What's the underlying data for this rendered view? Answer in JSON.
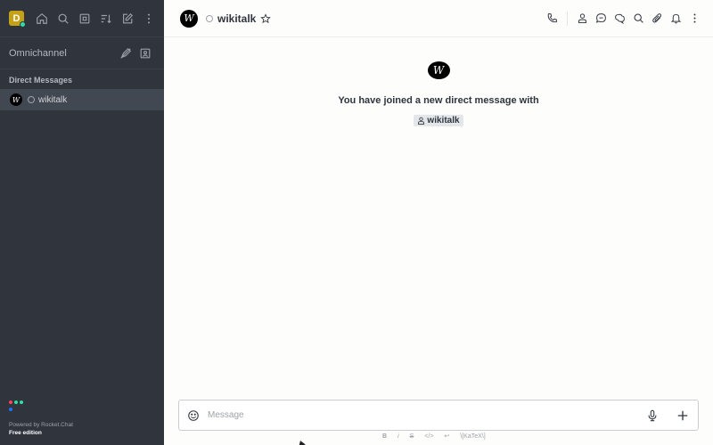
{
  "user": {
    "initial": "D",
    "status_color": "#2de0a5",
    "avatar_color": "#c4a116"
  },
  "sidebar": {
    "top_icons": [
      "home-icon",
      "search-icon",
      "directory-icon",
      "sort-icon",
      "write-icon",
      "kebab-icon"
    ],
    "omnichannel_label": "Omnichannel",
    "omnichannel_icons": [
      "queue-icon",
      "contact-center-icon"
    ],
    "section_title": "Direct Messages",
    "dm": {
      "avatar_letter": "W",
      "label": "wikitalk"
    },
    "footer": {
      "powered": "Powered by Rocket.Chat",
      "edition": "Free edition"
    }
  },
  "header": {
    "avatar_letter": "W",
    "title": "wikitalk",
    "actions": [
      "call-icon",
      "user-info-icon",
      "discussion-icon",
      "threads-icon",
      "search-icon",
      "attachment-icon",
      "bell-icon",
      "kebab-icon"
    ]
  },
  "room": {
    "avatar_letter": "W",
    "joined_text": "You have joined a new direct message with",
    "chip_user": "wikitalk"
  },
  "composer": {
    "placeholder": "Message",
    "format": [
      "B",
      "i",
      "S",
      "</>",
      "↩",
      "\\[KaTeX\\]"
    ]
  },
  "colors": {
    "sidebar_bg": "#2f343d",
    "active_item": "#414852",
    "main_bg": "#fdfdfc"
  }
}
